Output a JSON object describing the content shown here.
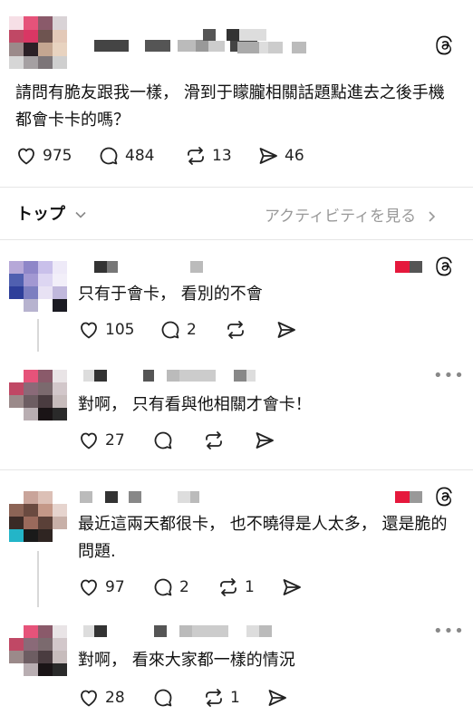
{
  "post": {
    "text_line1": "請問有脆友跟我一樣，  滑到于矇朧相關話題點進去之後手機",
    "text_line2": "都會卡卡的嗎？",
    "likes": "975",
    "replies": "484",
    "reposts": "13",
    "shares": "46"
  },
  "tabs": {
    "top_label": "トップ",
    "activity_label": "アクティビティを見る"
  },
  "comments": [
    {
      "text": "只有于會卡，  看別的不會",
      "likes": "105",
      "replies": "2",
      "reposts": ""
    },
    {
      "text": "對啊，  只有看與他相關才會卡！",
      "likes": "27",
      "replies": "",
      "reposts": ""
    },
    {
      "text_line1": "最近這兩天都很卡，  也不曉得是人太多，  還是脆的",
      "text_line2": "問題.",
      "likes": "97",
      "replies": "2",
      "reposts": "1"
    },
    {
      "text": "對啊，  看來大家都一樣的情況",
      "likes": "28",
      "replies": "",
      "reposts": "1"
    }
  ],
  "colors": {
    "accent_red": "#e5183c",
    "text": "#111111",
    "muted": "#999999",
    "divider": "#e6e6e6"
  },
  "icons": [
    "threads-logo-icon",
    "heart-icon",
    "comment-icon",
    "repost-icon",
    "share-icon",
    "chevron-down-icon",
    "chevron-right-icon",
    "more-icon"
  ]
}
